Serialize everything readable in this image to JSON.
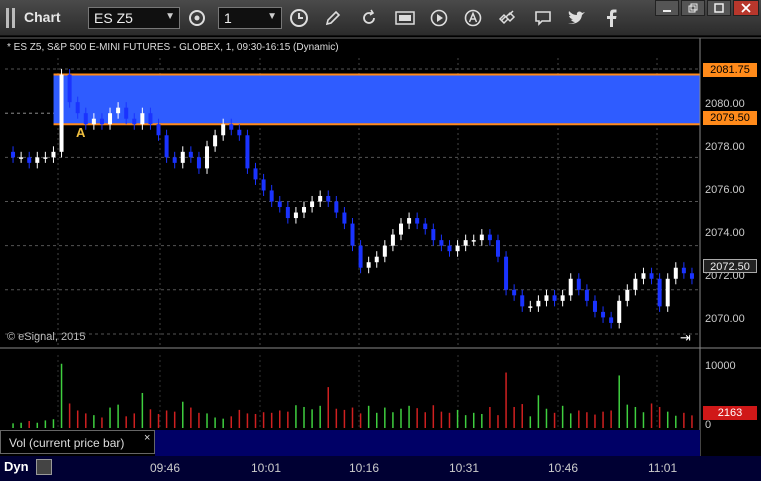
{
  "toolbar": {
    "title": "Chart",
    "symbol": "ES Z5",
    "interval": "1"
  },
  "chart": {
    "info": "* ES Z5, S&P 500 E-MINI FUTURES - GLOBEX, 1, 09:30-16:15 (Dynamic)",
    "copyright": "© eSignal, 2015",
    "price_ticks": [
      "2080.00",
      "2078.00",
      "2076.00",
      "2074.00",
      "2072.00",
      "2070.00"
    ],
    "price_tag_upper": "2081.75",
    "price_tag_lower": "2079.50",
    "price_tag_current": "2072.50",
    "marker": "A",
    "colors": {
      "band": "#2f5cff",
      "band_edge": "#ff8a1a",
      "up": "#ffffff",
      "down": "#1a33ff",
      "vol_up": "#3fcf3f",
      "vol_down": "#d02020"
    }
  },
  "volume": {
    "label": "Vol (current price bar)",
    "close": "×",
    "ticks": [
      "10000",
      "0"
    ],
    "current": "2163"
  },
  "time_axis": {
    "dyn": "Dyn",
    "labels": [
      "09:46",
      "10:01",
      "10:16",
      "10:31",
      "10:46",
      "11:01"
    ]
  },
  "chart_data": {
    "type": "candlestick",
    "x_unit": "1-minute bars",
    "ylim": [
      2069.5,
      2082.5
    ],
    "band": [
      2079.5,
      2081.75
    ],
    "closes": [
      2078,
      2078,
      2077.75,
      2078,
      2078,
      2078.25,
      2081.75,
      2080.5,
      2080,
      2079.5,
      2079.75,
      2079.5,
      2080,
      2080.25,
      2079.75,
      2079.5,
      2080,
      2079.5,
      2079,
      2078,
      2077.75,
      2078.25,
      2078,
      2077.5,
      2078.5,
      2079,
      2079.5,
      2079.25,
      2079,
      2077.5,
      2077,
      2076.5,
      2076,
      2075.75,
      2075.25,
      2075.5,
      2075.75,
      2076,
      2076.25,
      2076,
      2075.5,
      2075,
      2074,
      2073,
      2073.25,
      2073.5,
      2074,
      2074.5,
      2075,
      2075.25,
      2075,
      2074.75,
      2074.25,
      2074,
      2073.75,
      2074,
      2074.25,
      2074.25,
      2074.5,
      2074.25,
      2073.5,
      2072,
      2071.75,
      2071.25,
      2071.25,
      2071.5,
      2071.75,
      2071.5,
      2071.75,
      2072.5,
      2072,
      2071.5,
      2071,
      2070.75,
      2070.5,
      2071.5,
      2072,
      2072.5,
      2072.75,
      2072.5,
      2071.25,
      2072.5,
      2073,
      2072.75,
      2072.5
    ],
    "volumes": [
      800,
      900,
      1200,
      900,
      1300,
      1500,
      11000,
      4200,
      3000,
      2500,
      2200,
      1800,
      3500,
      4000,
      2000,
      2500,
      6000,
      3200,
      2400,
      3000,
      2800,
      4500,
      3500,
      2600,
      2500,
      1800,
      1600,
      2000,
      3100,
      2500,
      2400,
      2700,
      2600,
      3000,
      2800,
      3900,
      3600,
      3200,
      3800,
      7000,
      3300,
      3100,
      3500,
      2500,
      3800,
      2600,
      3500,
      2700,
      3300,
      3800,
      3400,
      2700,
      3900,
      2800,
      2600,
      3100,
      2200,
      2600,
      2400,
      3600,
      2200,
      9500,
      3600,
      4100,
      2000,
      5600,
      3300,
      2600,
      3800,
      2500,
      3000,
      2700,
      2300,
      2800,
      3000,
      9000,
      4000,
      3600,
      2700,
      4200,
      3600,
      2800,
      2100,
      2600,
      2163
    ]
  }
}
